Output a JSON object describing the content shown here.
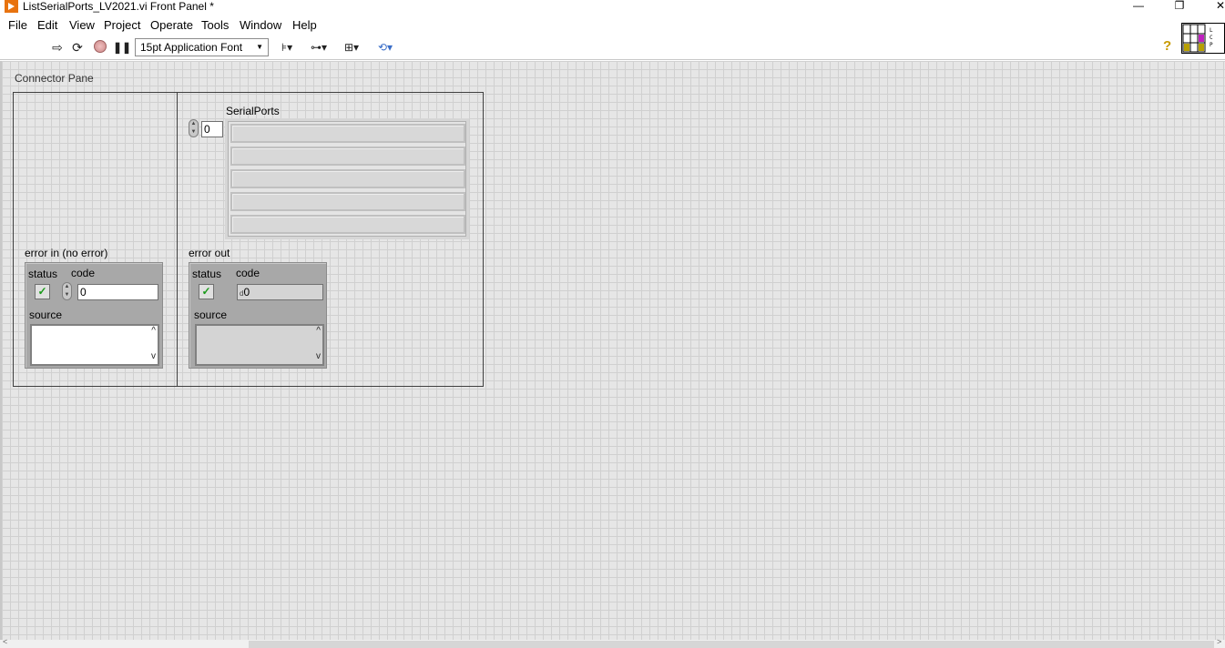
{
  "window": {
    "title": "ListSerialPorts_LV2021.vi Front Panel *",
    "controls": {
      "minimize": "—",
      "restore": "❐",
      "close": "✕"
    }
  },
  "menu": [
    "File",
    "Edit",
    "View",
    "Project",
    "Operate",
    "Tools",
    "Window",
    "Help"
  ],
  "toolbar": {
    "font": "15pt Application Font",
    "icons": [
      "run-arrow-icon",
      "run-continuously-icon",
      "abort-icon",
      "pause-icon",
      "align-objects-icon",
      "distribute-objects-icon",
      "resize-objects-icon",
      "reorder-icon",
      "help-icon"
    ]
  },
  "panel": {
    "connector_pane_label": "Connector Pane",
    "serial_ports": {
      "label": "SerialPorts",
      "index": "0",
      "element_count": 5
    },
    "error_in": {
      "label": "error in (no error)",
      "status_label": "status",
      "code_label": "code",
      "code_value": "0",
      "source_label": "source",
      "source_value": ""
    },
    "error_out": {
      "label": "error out",
      "status_label": "status",
      "code_label": "code",
      "code_value": "0",
      "code_prefix": "d",
      "source_label": "source",
      "source_value": ""
    }
  }
}
